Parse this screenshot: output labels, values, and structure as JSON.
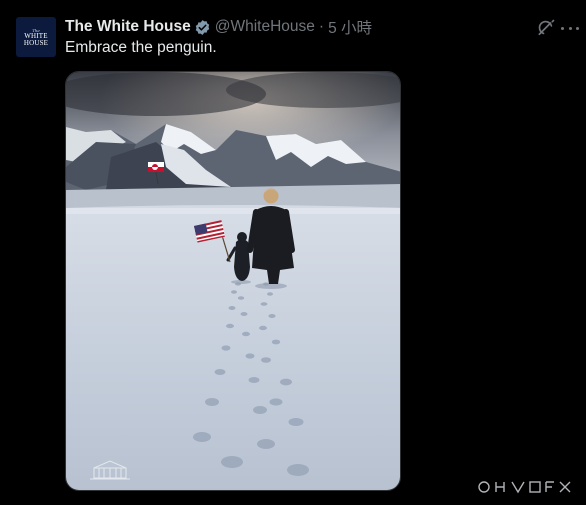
{
  "account": {
    "display_name": "The White House",
    "handle": "@WhiteHouse",
    "separator": "·",
    "time": "5 小時",
    "avatar_text_small": "The",
    "avatar_text_big_1": "WHITE",
    "avatar_text_big_2": "HOUSE",
    "verified": true
  },
  "tweet": {
    "text": "Embrace the penguin."
  },
  "icons": {
    "verified": "verified-badge-icon",
    "grok": "grok-icon",
    "more": "more-options-icon"
  },
  "colors": {
    "background": "#000000",
    "text_primary": "#e7e9ea",
    "text_secondary": "#71767b",
    "avatar_bg": "#0b1a3d"
  }
}
